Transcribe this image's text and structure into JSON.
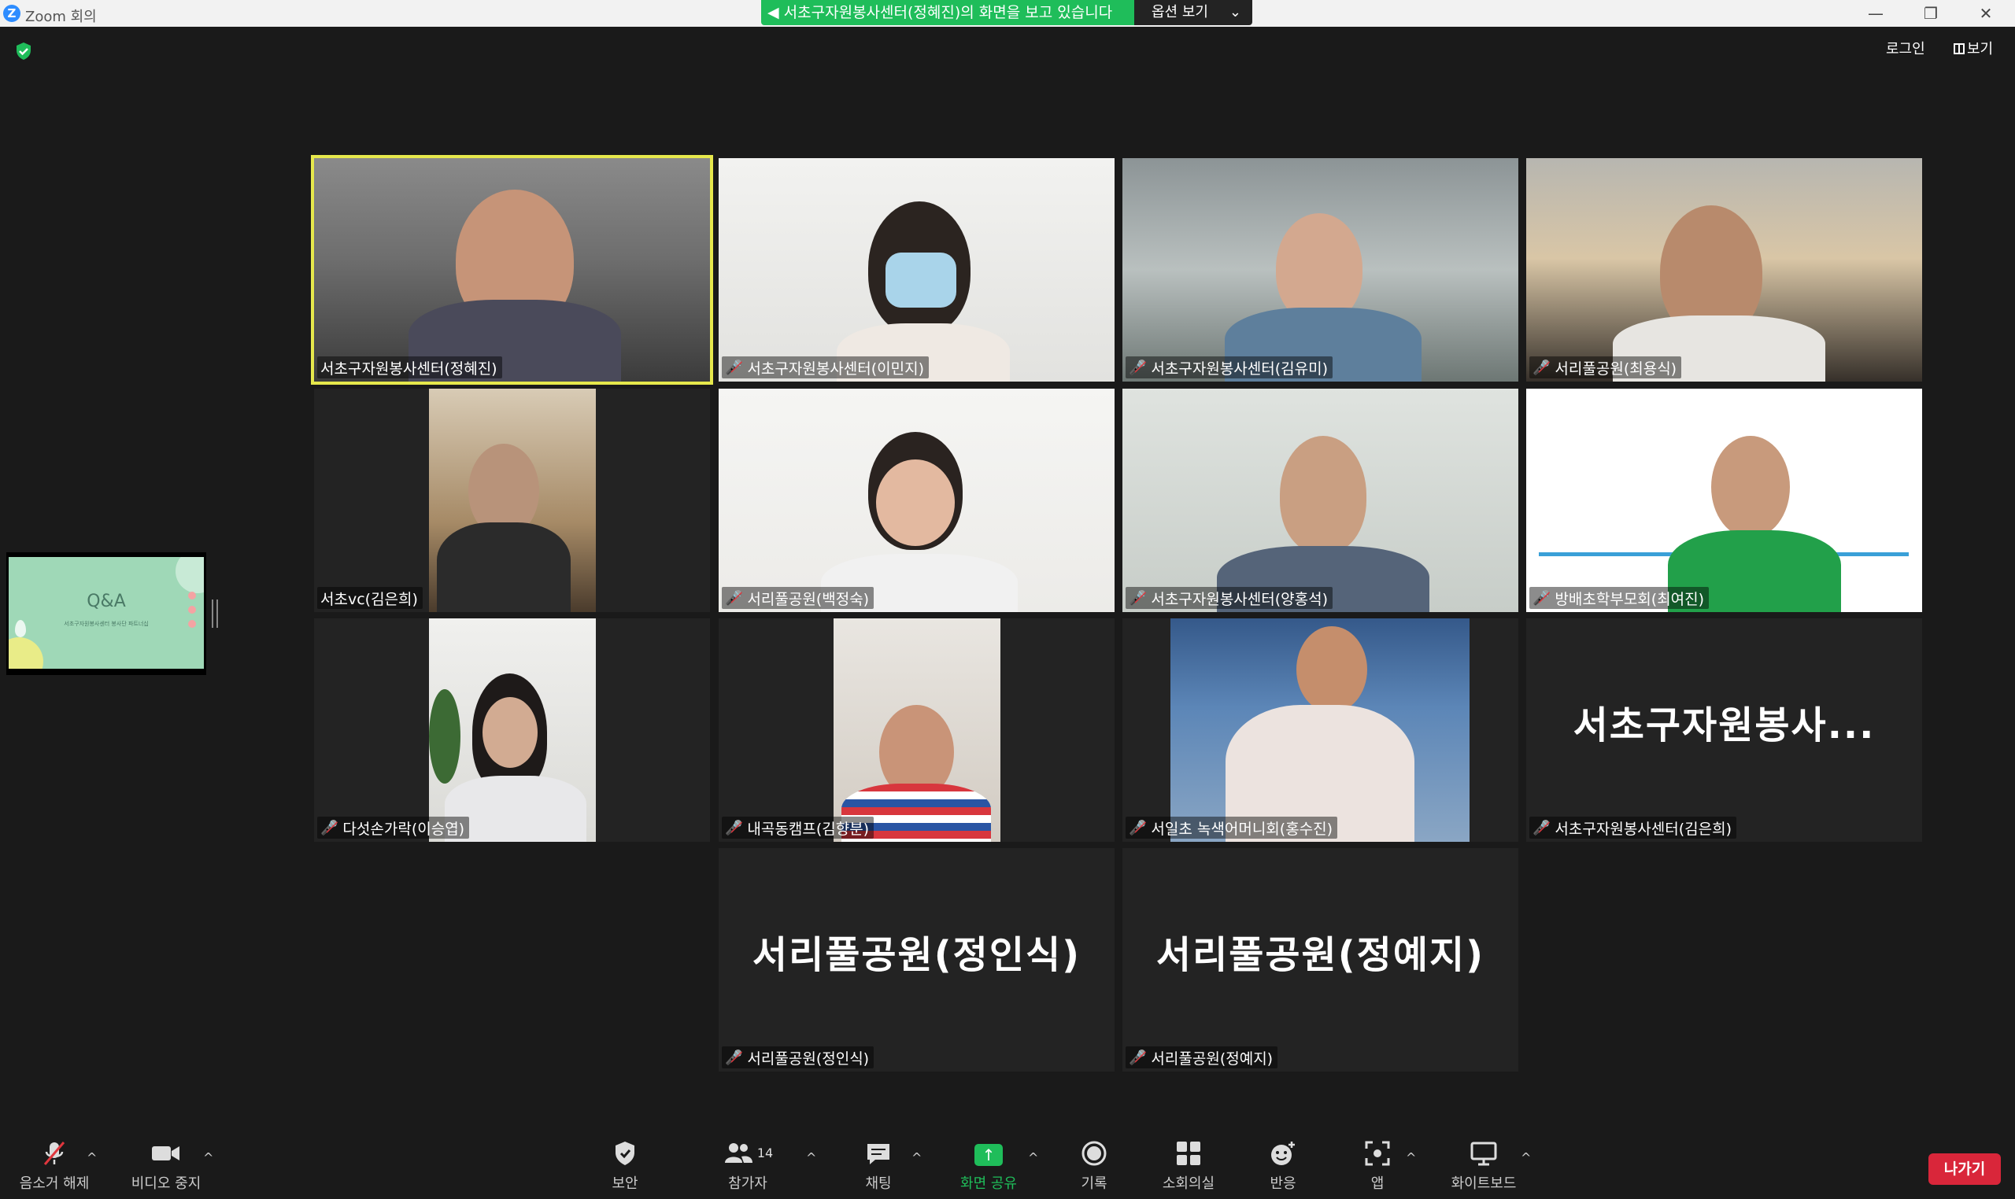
{
  "window": {
    "app_logo": "Z",
    "title": "Zoom 회의",
    "minimize": "—",
    "maximize": "❐",
    "close": "✕"
  },
  "share_banner": {
    "text": "서초구자원봉사센터(정혜진)의 화면을 보고 있습니다",
    "options_label": "옵션 보기",
    "options_chevron": "⌄"
  },
  "top_right": {
    "login": "로그인",
    "view": "보기"
  },
  "share_thumbnail": {
    "title": "Q&A",
    "subtitle": "서초구자원봉사센터 봉사단 파트너십"
  },
  "participants": [
    {
      "name": "서초구자원봉사센터(정혜진)",
      "muted": false,
      "active": true
    },
    {
      "name": "서초구자원봉사센터(이민지)",
      "muted": true
    },
    {
      "name": "서초구자원봉사센터(김유미)",
      "muted": true
    },
    {
      "name": "서리풀공원(최용식)",
      "muted": true
    },
    {
      "name": "서초vc(김은희)",
      "muted": false
    },
    {
      "name": "서리풀공원(백정숙)",
      "muted": true
    },
    {
      "name": "서초구자원봉사센터(양홍석)",
      "muted": true
    },
    {
      "name": "방배초학부모회(최여진)",
      "muted": true
    },
    {
      "name": "다섯손가락(이승엽)",
      "muted": true
    },
    {
      "name": "내곡동캠프(김향분)",
      "muted": true
    },
    {
      "name": "서일초 녹색어머니회(홍수진)",
      "muted": true
    },
    {
      "name": "서초구자원봉사센터(김은희)",
      "muted": true,
      "big_name": "서초구자원봉사..."
    },
    {
      "name": "서리풀공원(정인식)",
      "muted": true,
      "big_name": "서리풀공원(정인식)"
    },
    {
      "name": "서리풀공원(정예지)",
      "muted": true,
      "big_name": "서리풀공원(정예지)"
    }
  ],
  "toolbar": {
    "unmute": "음소거 해제",
    "stop_video": "비디오 중지",
    "security": "보안",
    "participants": "참가자",
    "participants_count": "14",
    "chat": "채팅",
    "share_screen": "화면 공유",
    "record": "기록",
    "breakout": "소회의실",
    "reactions": "반응",
    "apps": "앱",
    "whiteboard": "화이트보드",
    "leave": "나가기"
  },
  "icons": {
    "mic_off": "mic-slash",
    "caret": "^"
  },
  "colors": {
    "banner_green": "#1fbd5a",
    "active_border": "#e6e84c",
    "leave_red": "#d9263a",
    "muted_red": "#e0363d"
  }
}
